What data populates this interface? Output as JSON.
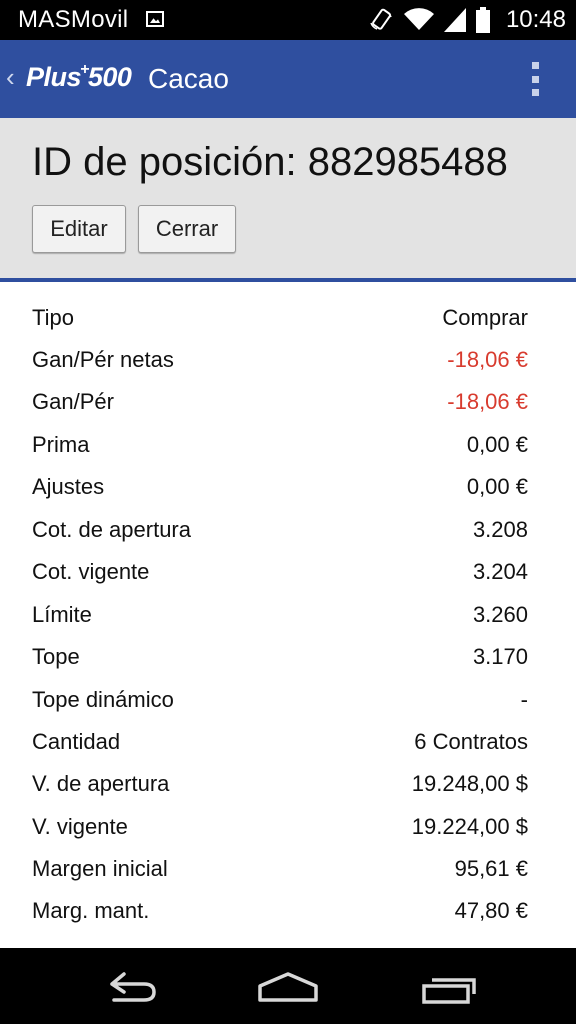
{
  "status_bar": {
    "carrier": "MASMovil",
    "time": "10:48",
    "icons": [
      "image-icon",
      "rotate-icon",
      "wifi-icon",
      "signal-icon",
      "battery-icon"
    ]
  },
  "app_bar": {
    "back_glyph": "‹",
    "logo_prefix": "Plus",
    "logo_plus": "+",
    "logo_suffix": "500",
    "title": "Cacao",
    "color": "#2f4f9f"
  },
  "position": {
    "title": "ID de posición: 882985488",
    "edit_label": "Editar",
    "close_label": "Cerrar"
  },
  "details": [
    {
      "label": "Tipo",
      "value": "Comprar",
      "negative": false
    },
    {
      "label": "Gan/Pér netas",
      "value": "-18,06 €",
      "negative": true
    },
    {
      "label": "Gan/Pér",
      "value": "-18,06 €",
      "negative": true
    },
    {
      "label": "Prima",
      "value": "0,00 €",
      "negative": false
    },
    {
      "label": "Ajustes",
      "value": "0,00 €",
      "negative": false
    },
    {
      "label": "Cot. de apertura",
      "value": "3.208",
      "negative": false
    },
    {
      "label": "Cot. vigente",
      "value": "3.204",
      "negative": false
    },
    {
      "label": "Límite",
      "value": "3.260",
      "negative": false
    },
    {
      "label": "Tope",
      "value": "3.170",
      "negative": false
    },
    {
      "label": "Tope dinámico",
      "value": "-",
      "negative": false
    },
    {
      "label": "Cantidad",
      "value": "6 Contratos",
      "negative": false
    },
    {
      "label": "V. de apertura",
      "value": "19.248,00 $",
      "negative": false
    },
    {
      "label": "V. vigente",
      "value": "19.224,00 $",
      "negative": false
    },
    {
      "label": "Margen inicial",
      "value": "95,61 €",
      "negative": false
    },
    {
      "label": "Marg. mant.",
      "value": "47,80 €",
      "negative": false
    }
  ],
  "colors": {
    "negative": "#d83b2e",
    "header_bg": "#e3e3e3"
  }
}
